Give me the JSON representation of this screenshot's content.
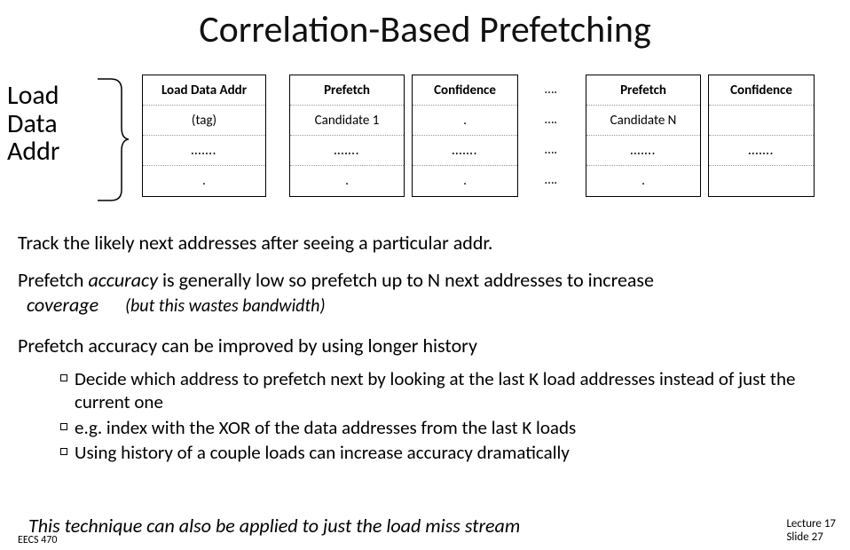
{
  "title": "Correlation-Based Prefetching",
  "sideLabel": {
    "l1": "Load",
    "l2": "Data",
    "l3": "Addr"
  },
  "table": {
    "col0": {
      "r0": "Load Data Addr",
      "r1": "(tag)",
      "r2": "…….",
      "r3": "."
    },
    "col1": {
      "r0": "Prefetch",
      "r1": "Candidate 1",
      "r2": "…….",
      "r3": "."
    },
    "col2": {
      "r0": "Confidence",
      "r1": ".",
      "r2": "…….",
      "r3": "."
    },
    "gap": {
      "r0": "….",
      "r1": "….",
      "r2": "….",
      "r3": "…."
    },
    "col3": {
      "r0": "Prefetch",
      "r1": "Candidate N",
      "r2": "…….",
      "r3": "."
    },
    "col4": {
      "r0": "Confidence",
      "r1": "",
      "r2": "…….",
      "r3": ""
    }
  },
  "para1": "Track the likely next addresses after seeing a particular addr.",
  "para2a": "Prefetch ",
  "para2a_em": "accuracy",
  "para2b": " is generally low so prefetch up to N next addresses to increase ",
  "para2b_em": "coverage",
  "para2_paren": "(but this wastes bandwidth)",
  "para3": "Prefetch accuracy can be improved by using longer history",
  "bullets": {
    "b1": "Decide which address to prefetch next by looking at the last K load addresses instead of just the current one",
    "b2": "e.g. index with the XOR of the data addresses from the last K loads",
    "b3": "Using history of a couple loads can increase accuracy dramatically"
  },
  "bottom": "This technique can also be applied to just the load miss stream",
  "footerLeft": "EECS 470",
  "footerRight": {
    "l1": "Lecture 17",
    "l2": "Slide 27"
  }
}
